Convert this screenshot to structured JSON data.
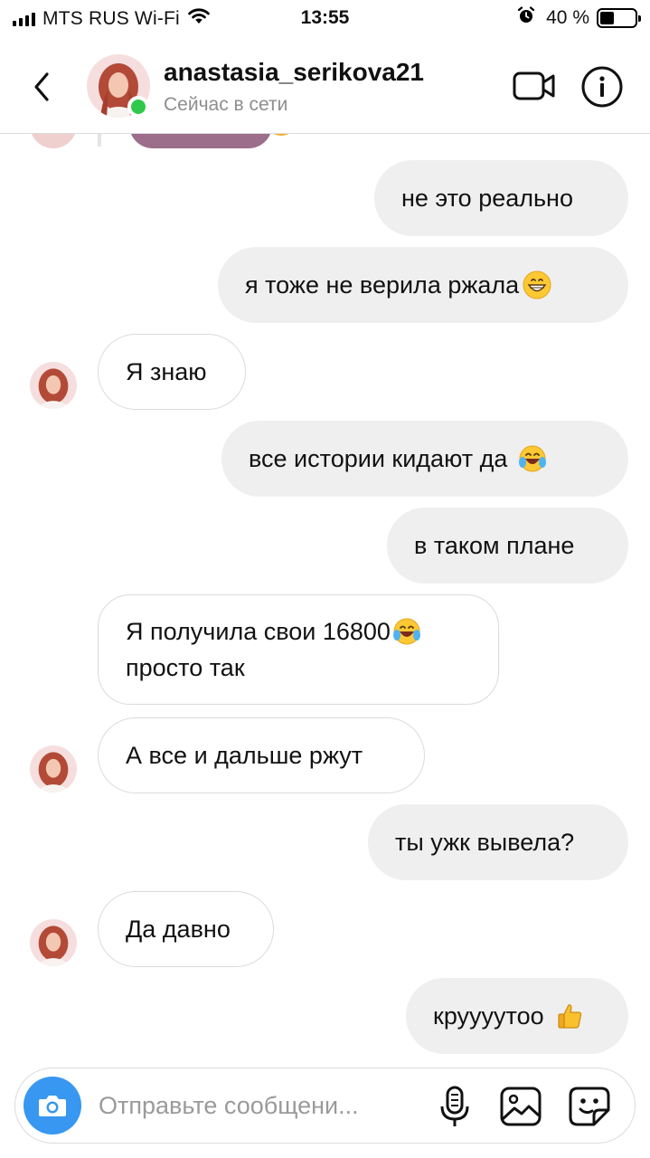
{
  "status_bar": {
    "carrier": "MTS RUS Wi-Fi",
    "time": "13:55",
    "battery": "40 %",
    "battery_level": 0.4
  },
  "header": {
    "username": "anastasia_serikova21",
    "status": "Сейчас в сети"
  },
  "messages": [
    {
      "sender": "me",
      "text": "не это реально"
    },
    {
      "sender": "me",
      "text": "я тоже не верила ржала",
      "emoji": "grinning-face-icon"
    },
    {
      "sender": "them",
      "text": "Я знаю"
    },
    {
      "sender": "me",
      "text": "все истории кидают да",
      "emoji": "tears-of-joy-icon"
    },
    {
      "sender": "me",
      "text": "в таком плане"
    },
    {
      "sender": "them",
      "text": "Я получила свои 16800",
      "text2": "просто так",
      "emoji": "tears-of-joy-icon"
    },
    {
      "sender": "them",
      "text": "А все и дальше ржут"
    },
    {
      "sender": "me",
      "text": "ты ужк вывела?"
    },
    {
      "sender": "them",
      "text": "Да давно"
    },
    {
      "sender": "me",
      "text": "круууутоо",
      "emoji": "thumbs-up-icon"
    }
  ],
  "compose": {
    "placeholder": "Отправьте сообщени..."
  },
  "colors": {
    "accent": "#3897f0",
    "online": "#2ec94a",
    "my_bubble": "#efefef",
    "their_bubble_border": "#dbdbdb"
  }
}
